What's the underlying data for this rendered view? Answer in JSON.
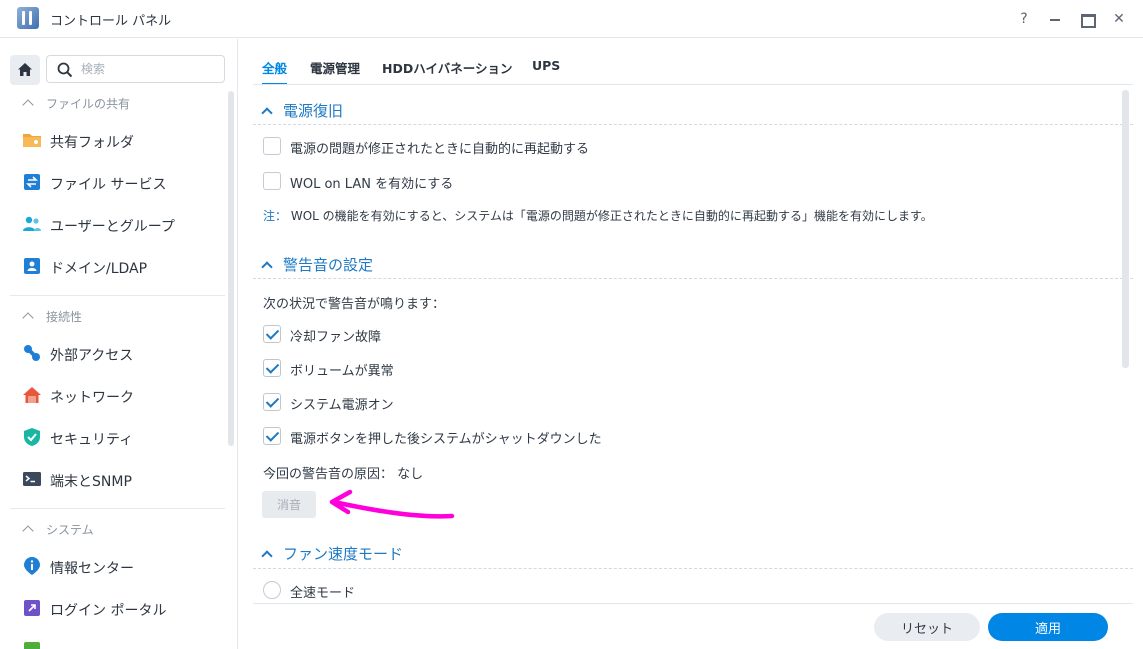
{
  "window": {
    "title": "コントロール パネル",
    "help": "?",
    "close": "✕"
  },
  "sidebar": {
    "search_placeholder": "検索",
    "sections": [
      {
        "title": "ファイルの共有",
        "items": [
          "共有フォルダ",
          "ファイル サービス",
          "ユーザーとグループ",
          "ドメイン/LDAP"
        ]
      },
      {
        "title": "接続性",
        "items": [
          "外部アクセス",
          "ネットワーク",
          "セキュリティ",
          "端末とSNMP"
        ]
      },
      {
        "title": "システム",
        "items": [
          "情報センター",
          "ログイン ポータル"
        ]
      }
    ]
  },
  "tabs": [
    "全般",
    "電源管理",
    "HDDハイバネーション",
    "UPS"
  ],
  "active_tab": "全般",
  "main": {
    "power_recovery": {
      "title": "電源復旧",
      "options": [
        {
          "label": "電源の問題が修正されたときに自動的に再起動する",
          "checked": false
        },
        {
          "label": "WOL on LAN を有効にする",
          "checked": false
        }
      ],
      "note_label": "注：",
      "note_text": "WOL の機能を有効にすると、システムは「電源の問題が修正されたときに自動的に再起動する」機能を有効にします。"
    },
    "beep": {
      "title": "警告音の設定",
      "intro": "次の状況で警告音が鳴ります：",
      "options": [
        {
          "label": "冷却ファン故障",
          "checked": true
        },
        {
          "label": "ボリュームが異常",
          "checked": true
        },
        {
          "label": "システム電源オン",
          "checked": true
        },
        {
          "label": "電源ボタンを押した後システムがシャットダウンした",
          "checked": true
        }
      ],
      "cause": "今回の警告音の原因： なし",
      "mute_button": "消音"
    },
    "fan": {
      "title": "ファン速度モード",
      "options": [
        "全速モード"
      ]
    }
  },
  "footer": {
    "reset": "リセット",
    "apply": "適用"
  },
  "colors": {
    "accent": "#0086e5",
    "heading": "#1d79c4",
    "annotation_arrow": "#ff00dd"
  }
}
